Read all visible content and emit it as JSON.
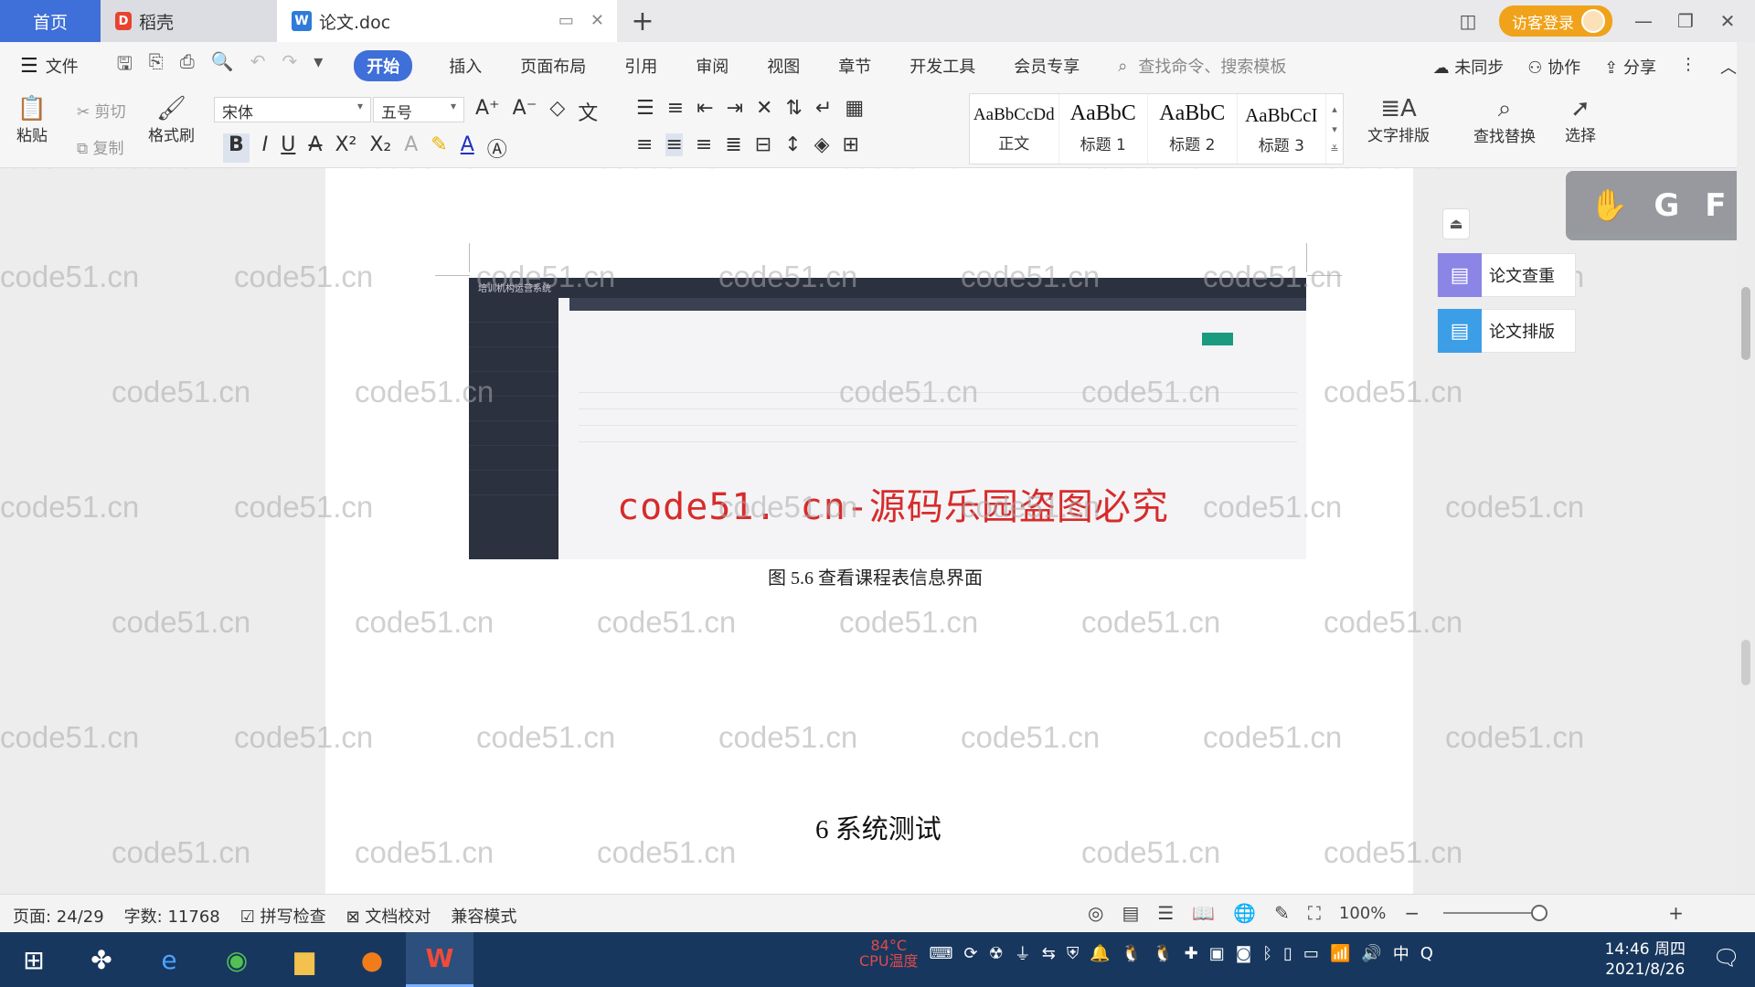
{
  "titlebar": {
    "tab_home": "首页",
    "tab_daoke": "稻壳",
    "tab_doc": "论文.doc",
    "login": "访客登录"
  },
  "menu": {
    "file": "文件",
    "items": [
      "开始",
      "插入",
      "页面布局",
      "引用",
      "审阅",
      "视图",
      "章节",
      "开发工具",
      "会员专享"
    ],
    "search_placeholder": "查找命令、搜索模板",
    "unsynced": "未同步",
    "collab": "协作",
    "share": "分享"
  },
  "ribbon": {
    "paste": "粘贴",
    "cut": "剪切",
    "copy": "复制",
    "format_painter": "格式刷",
    "font": "宋体",
    "size": "五号",
    "styles": [
      {
        "preview": "AaBbCcDd",
        "label": "正文"
      },
      {
        "preview": "AaBbC",
        "label": "标题 1"
      },
      {
        "preview": "AaBbC",
        "label": "标题 2"
      },
      {
        "preview": "AaBbCcI",
        "label": "标题 3"
      }
    ],
    "text_layout": "文字排版",
    "find_replace": "查找替换",
    "select": "选择"
  },
  "document": {
    "stamp": "code51. cn-源码乐园盗图必究",
    "caption": "图 5.6  查看课程表信息界面",
    "heading": "6 系统测试",
    "embedded_title": "培训机构运营系统"
  },
  "right_panel": {
    "check": "论文查重",
    "layout": "论文排版",
    "float_letters": [
      "G",
      "F"
    ]
  },
  "watermark": "code51.cn",
  "status": {
    "page": "页面: 24/29",
    "words": "字数: 11768",
    "spell": "拼写检查",
    "proof": "文档校对",
    "compat": "兼容模式",
    "zoom": "100%"
  },
  "taskbar": {
    "temp": "84°C",
    "temp_label": "CPU温度",
    "time": "14:46 周四",
    "date": "2021/8/26"
  }
}
